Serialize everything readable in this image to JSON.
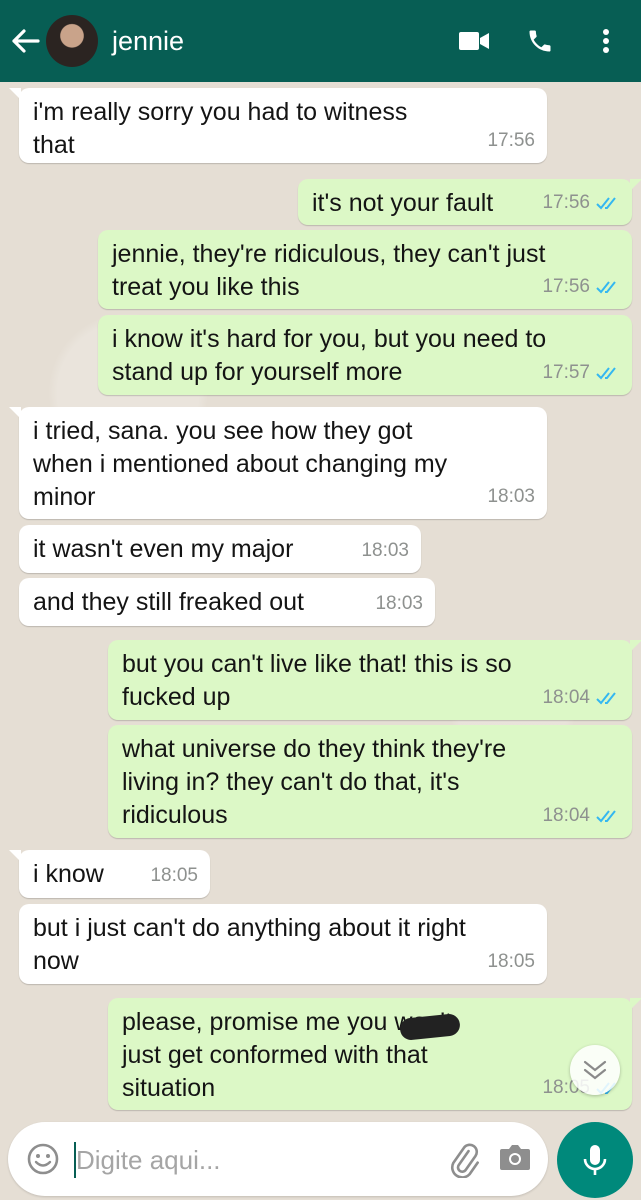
{
  "header": {
    "contact_name": "jennie",
    "icons": [
      "back-arrow-icon",
      "video-call-icon",
      "phone-icon",
      "more-options-icon"
    ],
    "bg_color": "#075e54"
  },
  "messages": [
    {
      "dir": "in",
      "text": "i'm really sorry you had to witness\nthat",
      "time": "17:56"
    },
    {
      "dir": "out",
      "text": "it's not your fault",
      "time": "17:56",
      "read": true
    },
    {
      "dir": "out",
      "text": "jennie, they're ridiculous, they can't just\ntreat you like this",
      "time": "17:56",
      "read": true
    },
    {
      "dir": "out",
      "text": "i know it's hard for you, but you need to\nstand up for yourself more",
      "time": "17:57",
      "read": true
    },
    {
      "dir": "in",
      "text": "i tried, sana. you see how they got\nwhen i mentioned about changing my\nminor",
      "time": "18:03"
    },
    {
      "dir": "in",
      "text": "it wasn't even my major",
      "time": "18:03"
    },
    {
      "dir": "in",
      "text": "and they still freaked out",
      "time": "18:03"
    },
    {
      "dir": "out",
      "text": "but you can't live like that! this is so\nfucked up",
      "time": "18:04",
      "read": true
    },
    {
      "dir": "out",
      "text": "what universe do they think they're\nliving in? they can't do that, it's\nridiculous",
      "time": "18:04",
      "read": true
    },
    {
      "dir": "in",
      "text": "i know",
      "time": "18:05"
    },
    {
      "dir": "in",
      "text": "but i just can't do anything about it right\nnow",
      "time": "18:05"
    },
    {
      "dir": "out",
      "text": "please, promise me you          won't\njust get conformed with that\nsituation",
      "time": "18:05",
      "read": true
    }
  ],
  "input": {
    "placeholder": "Digite aqui..."
  },
  "colors": {
    "incoming_bubble": "#ffffff",
    "outgoing_bubble": "#dcf8c6",
    "read_ticks": "#34b7f1",
    "mic_button": "#00897b"
  }
}
